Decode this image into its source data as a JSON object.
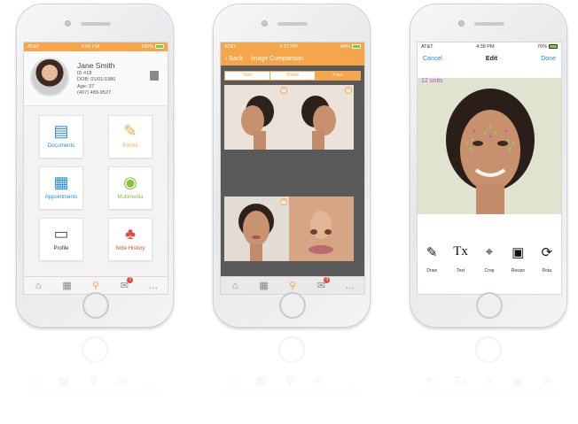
{
  "phone1": {
    "status": {
      "carrier": "AT&T",
      "time": "3:56 PM",
      "battery": "100%"
    },
    "patient": {
      "name": "Jane Smith",
      "id": "ID #18",
      "dob": "DOB: 01/01/1980",
      "age": "Age: 37",
      "phone": "(407) 489-9527"
    },
    "tiles": [
      {
        "label": "Documents",
        "icon": "documents-icon",
        "color": "#2f8bd6"
      },
      {
        "label": "Forms",
        "icon": "forms-icon",
        "color": "#f5a54a"
      },
      {
        "label": "Appointments",
        "icon": "calendar-icon",
        "color": "#2f8bd6"
      },
      {
        "label": "Multimedia",
        "icon": "camera-icon",
        "color": "#8cbf3f"
      },
      {
        "label": "Profile",
        "icon": "profile-card-icon",
        "color": "#333333"
      },
      {
        "label": "Note History",
        "icon": "note-history-icon",
        "color": "#e64a3b"
      }
    ],
    "tabbar": {
      "badge": "1"
    }
  },
  "phone2": {
    "status": {
      "carrier": "AT&T",
      "time": "4:37 PM",
      "battery": "94%"
    },
    "nav": {
      "back": "Back",
      "title": "Image Comparison"
    },
    "segments": [
      "Two",
      "Three",
      "Four"
    ],
    "active_segment": "Four",
    "tabbar": {
      "badge": "3"
    }
  },
  "phone3": {
    "status": {
      "carrier": "AT&T",
      "time": "4:38 PM",
      "battery": "76%"
    },
    "nav": {
      "cancel": "Cancel",
      "title": "Edit",
      "done": "Done"
    },
    "units": "12 units",
    "tools": [
      {
        "label": "Draw",
        "glyph": "✎"
      },
      {
        "label": "Text",
        "glyph": "Tx"
      },
      {
        "label": "Crop",
        "glyph": "⌖"
      },
      {
        "label": "Resize",
        "glyph": "▣"
      },
      {
        "label": "Rota",
        "glyph": "⟳"
      }
    ]
  },
  "colors": {
    "accent": "#f5a54a",
    "link": "#1a8be0",
    "badge": "#e64a3b",
    "units": "#c744d0"
  }
}
